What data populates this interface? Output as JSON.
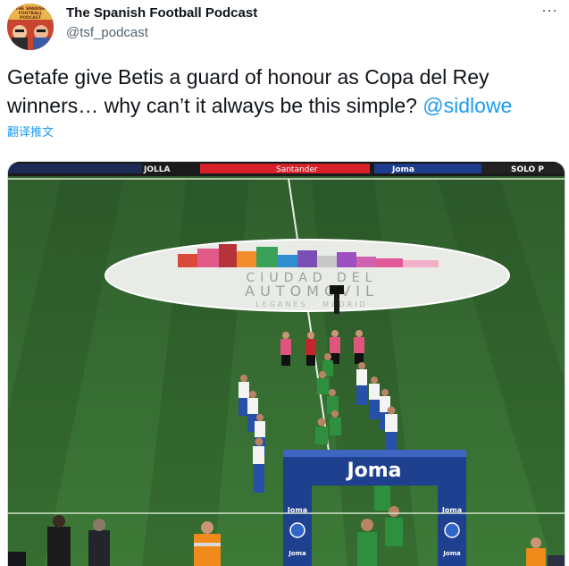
{
  "author": {
    "name": "The Spanish Football Podcast",
    "handle": "@tsf_podcast",
    "avatar_text": "THE SPANISH FOOTBALL PODCAST"
  },
  "tweet": {
    "text_before": "Getafe give Betis a guard of honour as Copa del Rey winners… why can’t it always be this simple? ",
    "mention": "@sidlowe",
    "translate_label": "翻译推文"
  },
  "media": {
    "kind": "photo",
    "banner_texts": [
      "JOLLA",
      "Santander",
      "Joma",
      "SOLO P"
    ],
    "center_logo_text": [
      "CIUDAD DEL",
      "AUTOMOVIL",
      "LEGANES · MADRID"
    ],
    "arch_text": "Joma",
    "arch_side_label": "Joma",
    "colors": {
      "pitch_light": "#3f7a3a",
      "pitch_dark": "#356c31",
      "arch_blue": "#1f3f8f",
      "betis_green": "#2e8f3f",
      "referee_pink": "#e0557d",
      "getafe_blue": "#2750a8"
    }
  },
  "ui": {
    "more_icon": "ellipsis-icon",
    "accent_color": "#1d9bf0"
  }
}
